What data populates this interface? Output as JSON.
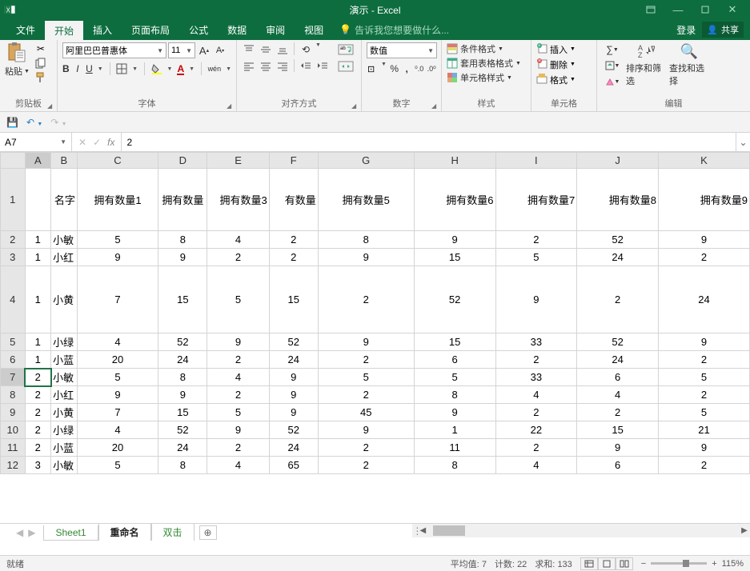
{
  "titlebar": {
    "title": "演示 - Excel"
  },
  "menu": {
    "file": "文件",
    "home": "开始",
    "insert": "插入",
    "layout": "页面布局",
    "formula": "公式",
    "data": "数据",
    "review": "审阅",
    "view": "视图",
    "tellme": "告诉我您想要做什么...",
    "login": "登录",
    "share": "共享"
  },
  "ribbon": {
    "clipboard": {
      "paste": "粘贴",
      "label": "剪贴板"
    },
    "font": {
      "name": "阿里巴巴普惠体",
      "size": "11",
      "label": "字体",
      "wen": "wén"
    },
    "align": {
      "wrap": "",
      "label": "对齐方式"
    },
    "number": {
      "format": "数值",
      "label": "数字"
    },
    "styles": {
      "cond": "条件格式",
      "table": "套用表格格式",
      "cell": "单元格样式",
      "label": "样式"
    },
    "cells": {
      "insert": "插入",
      "delete": "删除",
      "format": "格式",
      "label": "单元格"
    },
    "editing": {
      "sort": "排序和筛选",
      "find": "查找和选择",
      "label": "编辑"
    }
  },
  "fbar": {
    "ref": "A7",
    "value": "2"
  },
  "columns": [
    "A",
    "B",
    "C",
    "D",
    "E",
    "F",
    "G",
    "H",
    "I",
    "J",
    "K"
  ],
  "headerrow": [
    "",
    "名字",
    "拥有数量1",
    "拥有数量",
    "拥有数量3",
    "有数量",
    "拥有数量5",
    "拥有数量6",
    "拥有数量7",
    "拥有数量8",
    "拥有数量9"
  ],
  "rowheads": [
    "1",
    "2",
    "3",
    "4",
    "5",
    "6",
    "7",
    "8",
    "9",
    "10",
    "11",
    "12"
  ],
  "rows": [
    [
      "1",
      "小敏",
      5,
      8,
      4,
      2,
      8,
      9,
      2,
      52,
      9
    ],
    [
      "1",
      "小红",
      9,
      9,
      2,
      2,
      9,
      15,
      5,
      24,
      2
    ],
    [
      "1",
      "小黄",
      7,
      15,
      5,
      15,
      2,
      52,
      9,
      2,
      24
    ],
    [
      "1",
      "小绿",
      4,
      52,
      9,
      52,
      9,
      15,
      33,
      52,
      9
    ],
    [
      "1",
      "小蓝",
      20,
      24,
      2,
      24,
      2,
      6,
      2,
      24,
      2
    ],
    [
      "2",
      "小敏",
      5,
      8,
      4,
      9,
      5,
      5,
      33,
      6,
      5
    ],
    [
      "2",
      "小红",
      9,
      9,
      2,
      9,
      2,
      8,
      4,
      4,
      2
    ],
    [
      "2",
      "小黄",
      7,
      15,
      5,
      9,
      45,
      9,
      2,
      2,
      5
    ],
    [
      "2",
      "小绿",
      4,
      52,
      9,
      52,
      9,
      1,
      22,
      15,
      21
    ],
    [
      "2",
      "小蓝",
      20,
      24,
      2,
      24,
      2,
      11,
      2,
      9,
      9
    ],
    [
      "3",
      "小敏",
      5,
      8,
      4,
      65,
      2,
      8,
      4,
      6,
      2
    ]
  ],
  "tabs": {
    "sheet1": "Sheet1",
    "rename": "重命名",
    "dblclick": "双击"
  },
  "status": {
    "ready": "就绪",
    "avg_l": "平均值:",
    "avg_v": "7",
    "cnt_l": "计数:",
    "cnt_v": "22",
    "sum_l": "求和:",
    "sum_v": "133",
    "zoom": "115%"
  }
}
